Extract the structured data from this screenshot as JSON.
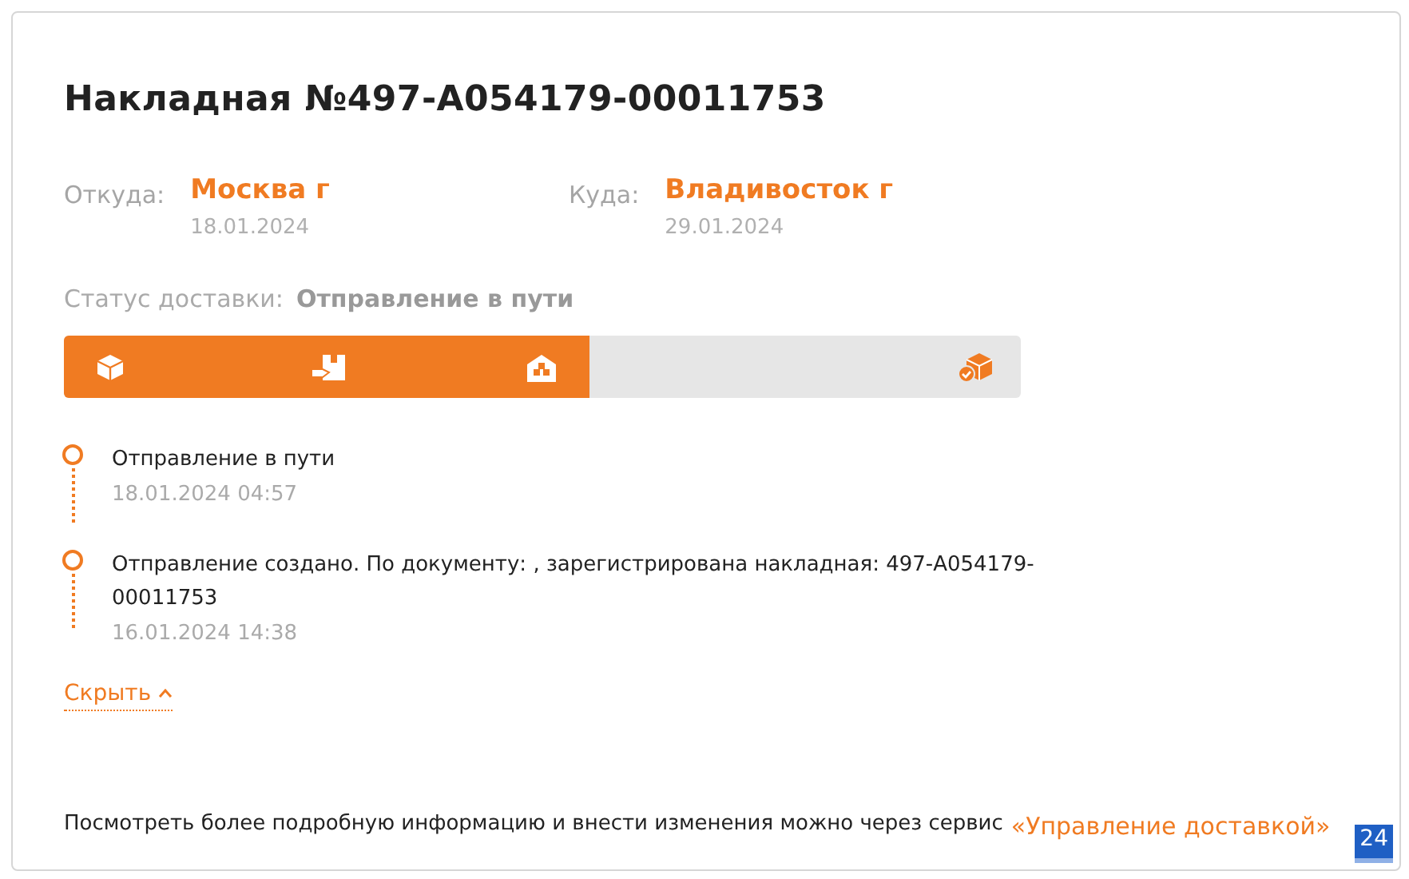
{
  "title": "Накладная №497-A054179-00011753",
  "route": [
    {
      "label": "Откуда:",
      "city": "Москва г",
      "date": "18.01.2024"
    },
    {
      "label": "Куда:",
      "city": "Владивосток г",
      "date": "29.01.2024"
    }
  ],
  "status": {
    "label": "Статус доставки:",
    "value": "Отправление в пути"
  },
  "progress": {
    "level": 0.55,
    "stages": [
      {
        "kind": "box"
      },
      {
        "kind": "handover"
      },
      {
        "kind": "warehouse"
      },
      {
        "kind": "delivered"
      }
    ]
  },
  "events": [
    {
      "text": "Отправление в пути",
      "time": "18.01.2024 04:57"
    },
    {
      "text": "Отправление создано. По документу: , зарегистрирована накладная: 497-A054179-00011753",
      "time": "16.01.2024 14:38"
    }
  ],
  "toggle": {
    "label": "Скрыть",
    "expanded": true
  },
  "footer": {
    "text": "Посмотреть более подробную информацию и внести изменения можно через сервис",
    "link": "«Управление доставкой»"
  },
  "badge": "24"
}
